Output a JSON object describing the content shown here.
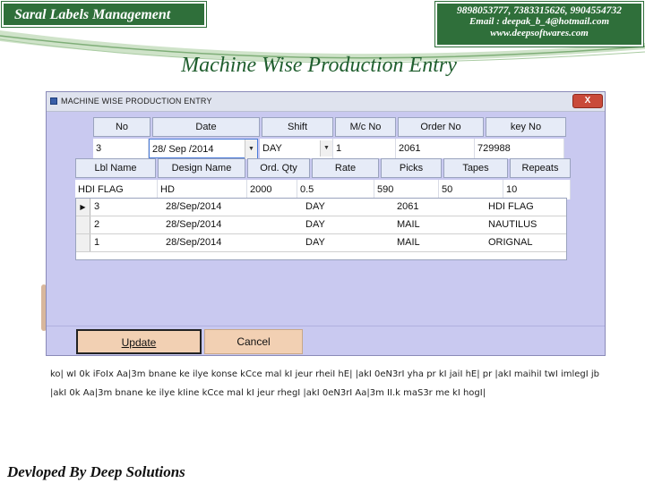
{
  "slide": {
    "brand_title": "Saral Labels Management",
    "contact_phones": "9898053777, 7383315626, 9904554732",
    "contact_email": "Email : deepak_b_4@hotmail.com",
    "contact_web": "www.deepsoftwares.com",
    "heading": "Machine Wise Production Entry",
    "footer": "Devloped By Deep Solutions",
    "note_line1": "ko| wI 0k iFoIx Aa|3m bnane ke ilye konse kCce mal kI jeur rheiI hE| |akI 0eN3rI yha pr kI jaiI hE| pr |akI maihiI twI imlegI jb",
    "note_line2": "|akI 0k Aa|3m bnane ke ilye kIine kCce mal kI jeur rhegI |akI 0eN3rI Aa|3m II.k maS3r me kI hogI|",
    "accent_color": "#2f6f3a"
  },
  "window": {
    "title": "MACHINE WISE PRODUCTION ENTRY",
    "close_label": "X",
    "row1": {
      "headers": [
        "No",
        "Date",
        "Shift",
        "M/c No",
        "Order No",
        "key No"
      ],
      "values": {
        "no": "3",
        "date": "28/ Sep /2014",
        "shift": "DAY",
        "mc_no": "1",
        "order_no": "2061",
        "key_no": "729988"
      }
    },
    "row2": {
      "headers": [
        "Lbl Name",
        "Design Name",
        "Ord. Qty",
        "Rate",
        "Picks",
        "Tapes",
        "Repeats"
      ],
      "values": {
        "lbl_name": "HDI FLAG",
        "design_name": "HD",
        "ord_qty": "2000",
        "rate": "0.5",
        "picks": "590",
        "tapes": "50",
        "repeats": "10"
      }
    },
    "list": [
      {
        "no": "3",
        "date": "28/Sep/2014",
        "shift": "DAY",
        "order": "2061",
        "label": "HDI FLAG"
      },
      {
        "no": "2",
        "date": "28/Sep/2014",
        "shift": "DAY",
        "order": "MAIL",
        "label": "NAUTILUS"
      },
      {
        "no": "1",
        "date": "28/Sep/2014",
        "shift": "DAY",
        "order": "MAIL",
        "label": "ORIGNAL"
      }
    ],
    "update_label": "Update",
    "cancel_label": "Cancel"
  }
}
